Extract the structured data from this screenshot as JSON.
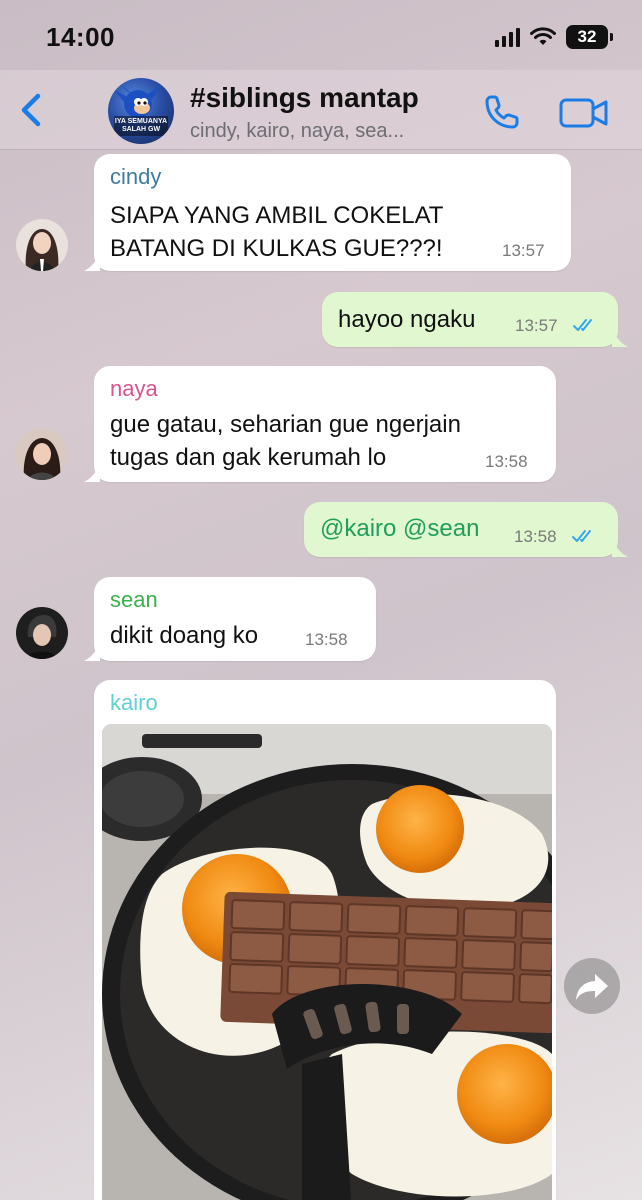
{
  "status": {
    "time": "14:00",
    "battery": "32"
  },
  "header": {
    "title": "#siblings mantap",
    "subtitle": "cindy, kairo, naya, sea...",
    "avatar_caption": "IYA SEMUANYA SALAH GW"
  },
  "colors": {
    "accent": "#1a7de6",
    "outgoing_bubble": "#e1f7cf",
    "incoming_bubble": "#ffffff",
    "read_ticks": "#34a7e8",
    "cindy": "#3f7ba3",
    "naya": "#d9558c",
    "sean": "#3bb14f",
    "kairo": "#5fd1d3",
    "mention": "#1f9e5e"
  },
  "messages": [
    {
      "sender": "cindy",
      "lines": [
        "SIAPA YANG AMBIL COKELAT",
        "BATANG DI KULKAS GUE???!"
      ],
      "time": "13:57"
    },
    {
      "sender": "",
      "lines": [
        "hayoo ngaku"
      ],
      "time": "13:57",
      "outgoing": true
    },
    {
      "sender": "naya",
      "lines": [
        "gue gatau, seharian gue ngerjain",
        "tugas dan gak kerumah lo"
      ],
      "time": "13:58"
    },
    {
      "sender": "",
      "lines": [
        "@kairo @sean"
      ],
      "time": "13:58",
      "outgoing": true
    },
    {
      "sender": "sean",
      "lines": [
        "dikit doang ko"
      ],
      "time": "13:58"
    },
    {
      "sender": "kairo",
      "type": "photo"
    }
  ],
  "icons": [
    "back-chevron-icon",
    "phone-icon",
    "video-camera-icon",
    "double-check-icon",
    "forward-icon"
  ]
}
